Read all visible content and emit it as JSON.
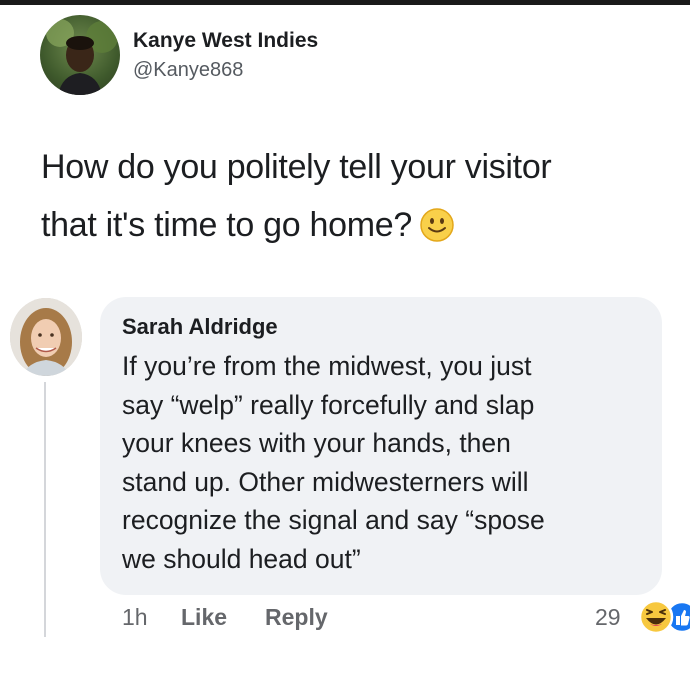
{
  "tweet": {
    "author_name": "Kanye West Indies",
    "handle": "@Kanye868",
    "text_lines": [
      "How do you politely tell your visitor",
      "that it's time to go home?"
    ],
    "emoji": "slightly-smiling-face-icon"
  },
  "comment": {
    "author_name": "Sarah Aldridge",
    "text_lines": [
      "If you’re from the midwest, you just",
      "say “welp” really forcefully and slap",
      "your knees with your hands, then",
      "stand up. Other midwesterners will",
      "recognize the signal and say “spose",
      "we should head out”"
    ],
    "time": "1h",
    "like_label": "Like",
    "reply_label": "Reply",
    "reaction_count": "29",
    "reactions": [
      "haha-reaction-icon",
      "like-reaction-icon"
    ]
  },
  "colors": {
    "bubble_bg": "#f0f2f5",
    "secondary_text": "#65676b",
    "reaction_yellow": "#f7c83f",
    "like_blue": "#1877f2"
  }
}
